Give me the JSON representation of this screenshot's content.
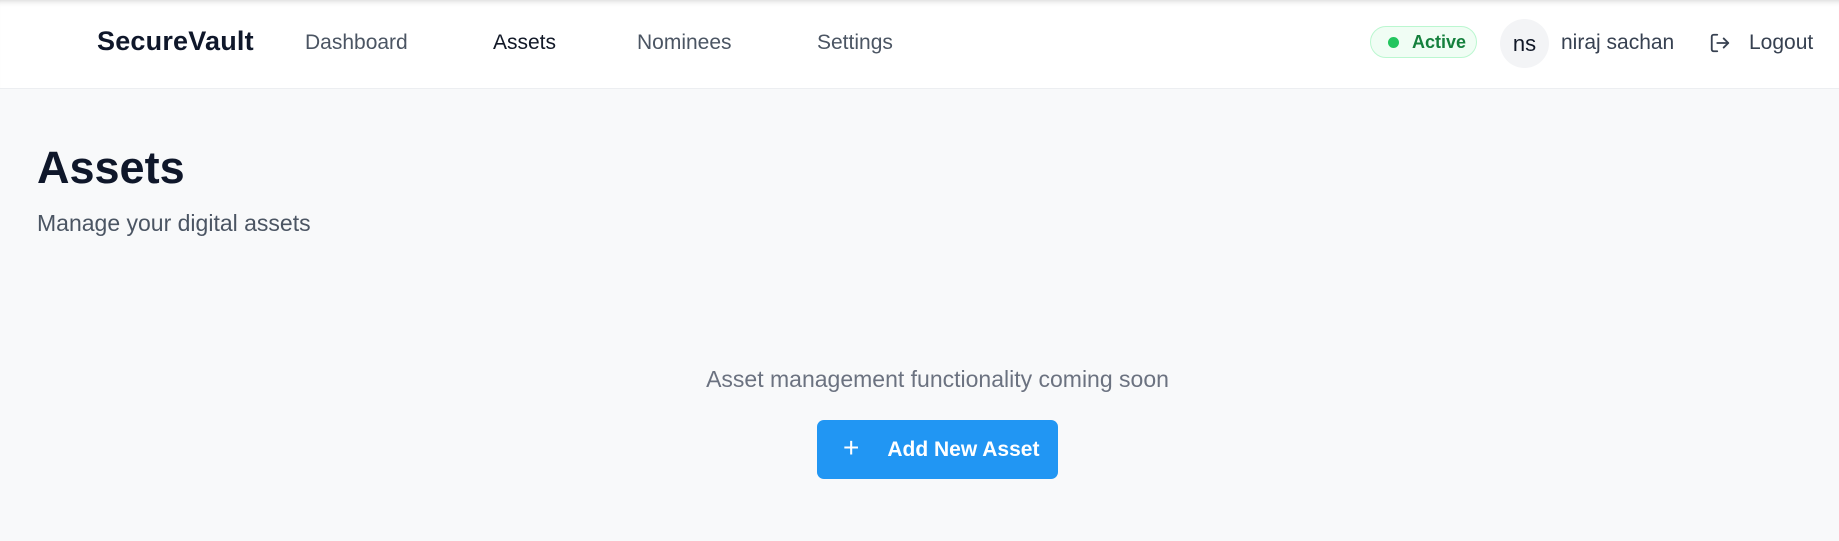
{
  "header": {
    "brand": "SecureVault",
    "nav": [
      {
        "label": "Dashboard",
        "active": false
      },
      {
        "label": "Assets",
        "active": true
      },
      {
        "label": "Nominees",
        "active": false
      },
      {
        "label": "Settings",
        "active": false
      }
    ],
    "status": {
      "label": "Active",
      "color": "#22c55e"
    },
    "user": {
      "initials": "ns",
      "name": "niraj sachan"
    },
    "logout": {
      "label": "Logout",
      "icon": "logout-icon"
    }
  },
  "main": {
    "title": "Assets",
    "subtitle": "Manage your digital assets",
    "empty_message": "Asset management functionality coming soon",
    "add_button": {
      "icon": "plus-icon",
      "label": "Add New Asset",
      "color": "#2196f3"
    }
  }
}
